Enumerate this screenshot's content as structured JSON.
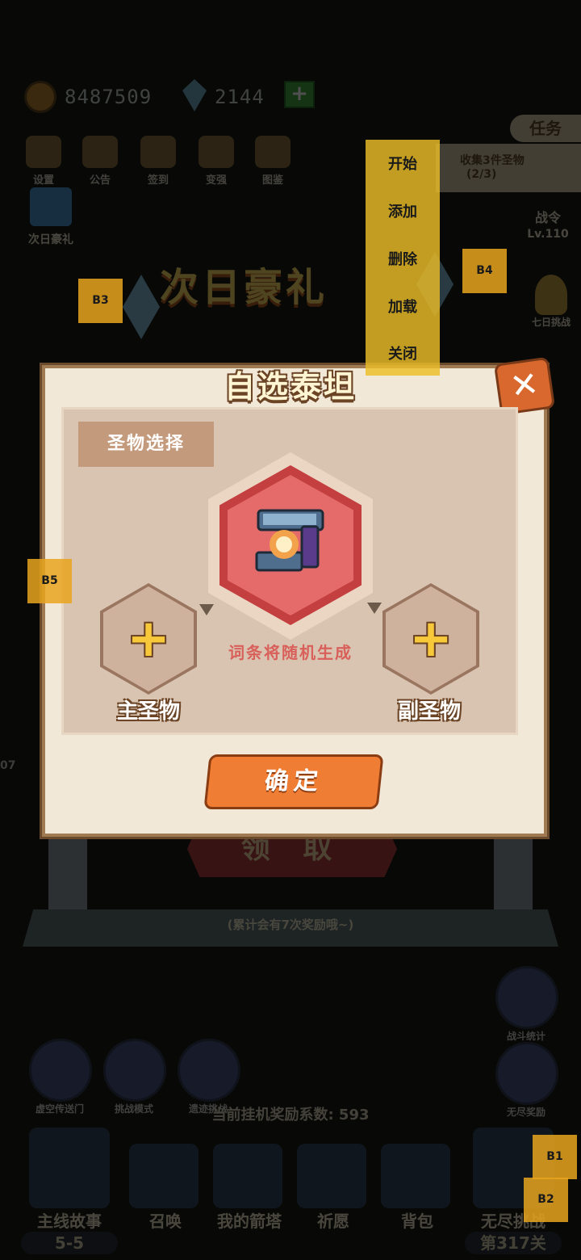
{
  "top_bar": {
    "gold": "8487509",
    "diamonds": "2144",
    "plus_label": "+",
    "buttons": [
      {
        "label": "设置",
        "icon": "gear-icon"
      },
      {
        "label": "公告",
        "icon": "scroll-icon"
      },
      {
        "label": "签到",
        "icon": "feather-icon"
      },
      {
        "label": "变强",
        "icon": "fist-icon"
      },
      {
        "label": "图鉴",
        "icon": "book-icon"
      }
    ],
    "daily_gift_label": "次日豪礼"
  },
  "task": {
    "tab_label": "任务",
    "description": "收集3件圣物",
    "progress": "(2/3)"
  },
  "right_side": {
    "battle_pass_label": "战令",
    "battle_pass_level": "Lv.110",
    "seven_day_label": "七日挑战"
  },
  "banner": {
    "title": "次日豪礼"
  },
  "claim_area": {
    "claim_label": "领 取",
    "footer_note": "(累计会有7次奖励哦~)"
  },
  "bottom": {
    "round_buttons": [
      "虚空传送门",
      "挑战模式",
      "遗迹挑战"
    ],
    "battle_stats_label": "战斗统计",
    "endless_reward_label": "无尽奖励",
    "idle_coefficient": "当前挂机奖励系数: 593",
    "nav": [
      {
        "label": "主线故事",
        "sub": "5-5"
      },
      {
        "label": "召唤"
      },
      {
        "label": "我的箭塔"
      },
      {
        "label": "祈愿"
      },
      {
        "label": "背包"
      },
      {
        "label": "无尽挑战",
        "sub": "第317关"
      }
    ],
    "left_timer": "07"
  },
  "modal": {
    "title": "自选泰坦",
    "section_title": "圣物选择",
    "hint": "词条将随机生成",
    "main_slot_label": "主圣物",
    "sub_slot_label": "副圣物",
    "plus_glyph": "+",
    "confirm_label": "确定",
    "close_glyph": "✕"
  },
  "context_menu": {
    "items": [
      "开始",
      "添加",
      "删除",
      "加载",
      "关闭"
    ]
  },
  "tags": [
    "B1",
    "B2",
    "B3",
    "B4",
    "B5"
  ],
  "colors": {
    "menu_bg": "#ecbe28",
    "tag_bg": "#e8a51e",
    "confirm": "#ef7d33",
    "relic_hex": "#e56b6b"
  }
}
